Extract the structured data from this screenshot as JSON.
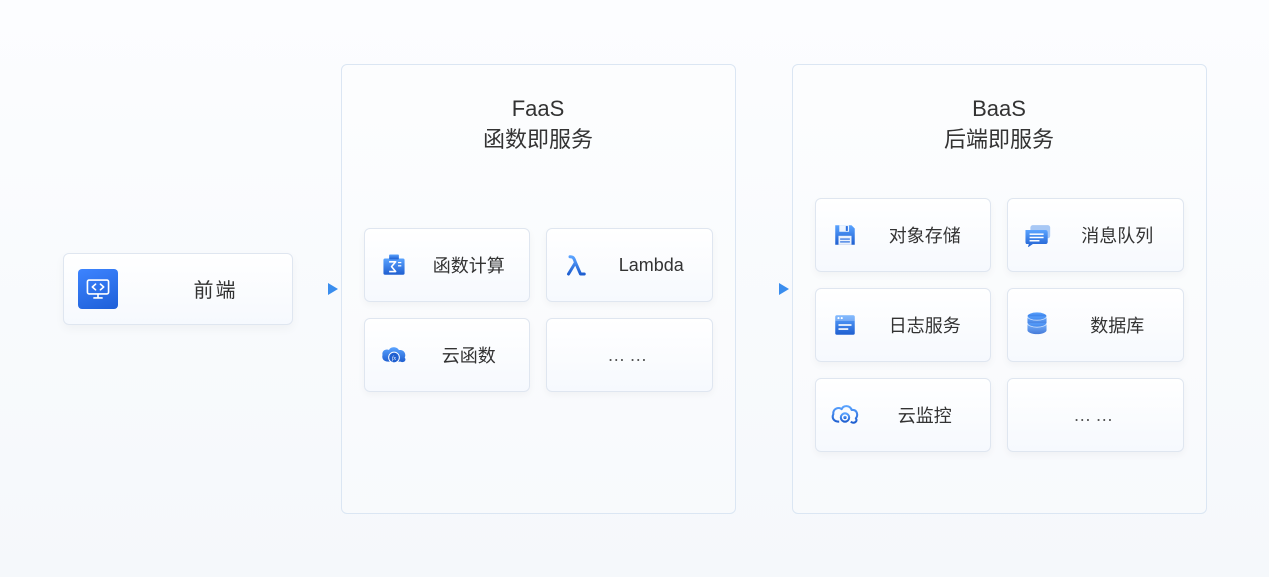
{
  "frontend": {
    "label": "前端"
  },
  "faas": {
    "title_line1": "FaaS",
    "title_line2": "函数即服务",
    "cards": [
      {
        "label": "函数计算"
      },
      {
        "label": "Lambda"
      },
      {
        "label": "云函数"
      },
      {
        "label": "……"
      }
    ]
  },
  "baas": {
    "title_line1": "BaaS",
    "title_line2": "后端即服务",
    "cards": [
      {
        "label": "对象存储"
      },
      {
        "label": "消息队列"
      },
      {
        "label": "日志服务"
      },
      {
        "label": "数据库"
      },
      {
        "label": "云监控"
      },
      {
        "label": "……"
      }
    ]
  }
}
